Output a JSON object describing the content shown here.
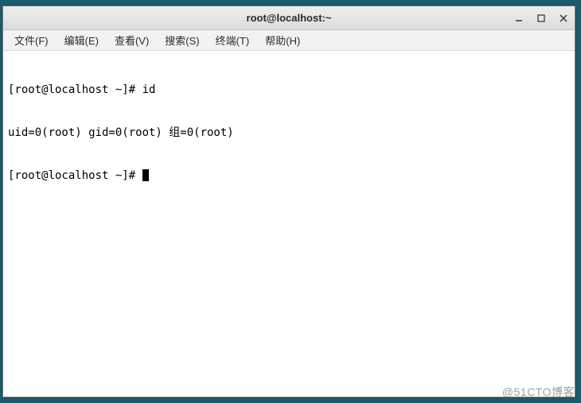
{
  "window": {
    "title": "root@localhost:~"
  },
  "menu": {
    "file": "文件(F)",
    "edit": "编辑(E)",
    "view": "查看(V)",
    "search": "搜索(S)",
    "terminal": "终端(T)",
    "help": "帮助(H)"
  },
  "terminal": {
    "line1_prompt": "[root@localhost ~]# ",
    "line1_cmd": "id",
    "line2": "uid=0(root) gid=0(root) 组=0(root)",
    "line3_prompt": "[root@localhost ~]# "
  },
  "watermark": "@51CTO博客"
}
